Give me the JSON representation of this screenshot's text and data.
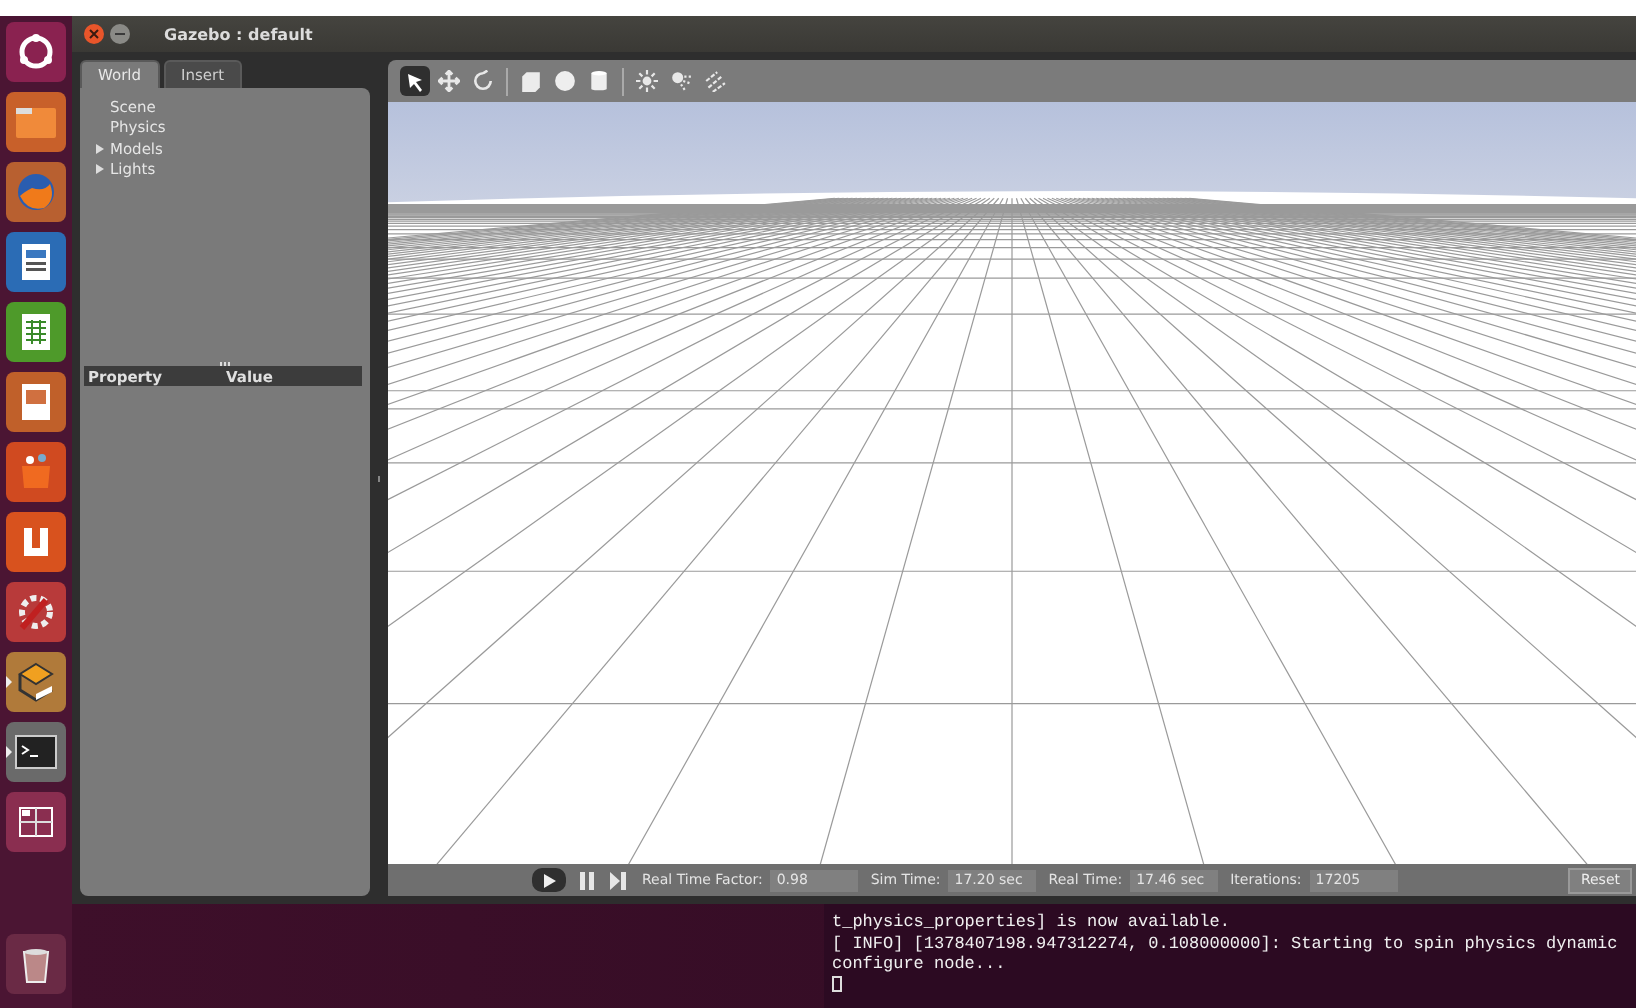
{
  "launcher": {
    "items": [
      {
        "kind": "dash",
        "selected": false
      },
      {
        "kind": "folder",
        "selected": false
      },
      {
        "kind": "browser",
        "selected": false
      },
      {
        "kind": "writer",
        "selected": false
      },
      {
        "kind": "calc",
        "selected": false
      },
      {
        "kind": "impress",
        "selected": false
      },
      {
        "kind": "store",
        "selected": false
      },
      {
        "kind": "ubuntu-one",
        "selected": false
      },
      {
        "kind": "settings",
        "selected": false
      },
      {
        "kind": "gazebo",
        "selected": true
      },
      {
        "kind": "terminal",
        "selected": true
      },
      {
        "kind": "workspaces",
        "selected": false
      },
      {
        "kind": "trash",
        "selected": false
      }
    ]
  },
  "window": {
    "title": "Gazebo : default"
  },
  "tabs": [
    {
      "label": "World",
      "selected": true
    },
    {
      "label": "Insert",
      "selected": false
    }
  ],
  "tree": [
    {
      "label": "Scene",
      "expandable": false
    },
    {
      "label": "Physics",
      "expandable": false
    },
    {
      "label": "Models",
      "expandable": true
    },
    {
      "label": "Lights",
      "expandable": true
    }
  ],
  "properties": {
    "columns": [
      "Property",
      "Value"
    ]
  },
  "toolbar": [
    {
      "kind": "select",
      "selected": true
    },
    {
      "kind": "translate",
      "selected": false
    },
    {
      "kind": "rotate",
      "selected": false
    },
    {
      "kind": "separator"
    },
    {
      "kind": "box",
      "selected": false
    },
    {
      "kind": "sphere",
      "selected": false
    },
    {
      "kind": "cylinder",
      "selected": false
    },
    {
      "kind": "separator"
    },
    {
      "kind": "point-light",
      "selected": false
    },
    {
      "kind": "spot-light",
      "selected": false
    },
    {
      "kind": "directional-light",
      "selected": false
    }
  ],
  "status_bar": {
    "controls": [
      {
        "kind": "play"
      },
      {
        "kind": "pause"
      },
      {
        "kind": "step"
      }
    ],
    "fields": [
      {
        "label": "Real Time Factor:",
        "value": "0.98"
      },
      {
        "label": "Sim Time:",
        "value": "17.20 sec"
      },
      {
        "label": "Real Time:",
        "value": "17.46 sec"
      },
      {
        "label": "Iterations:",
        "value": "17205"
      }
    ],
    "reset": "Reset"
  },
  "terminal": {
    "lines": [
      "t_physics_properties] is now available.",
      "[ INFO] [1378407198.947312274, 0.108000000]: Starting to spin physics dynamic",
      "configure node..."
    ]
  }
}
